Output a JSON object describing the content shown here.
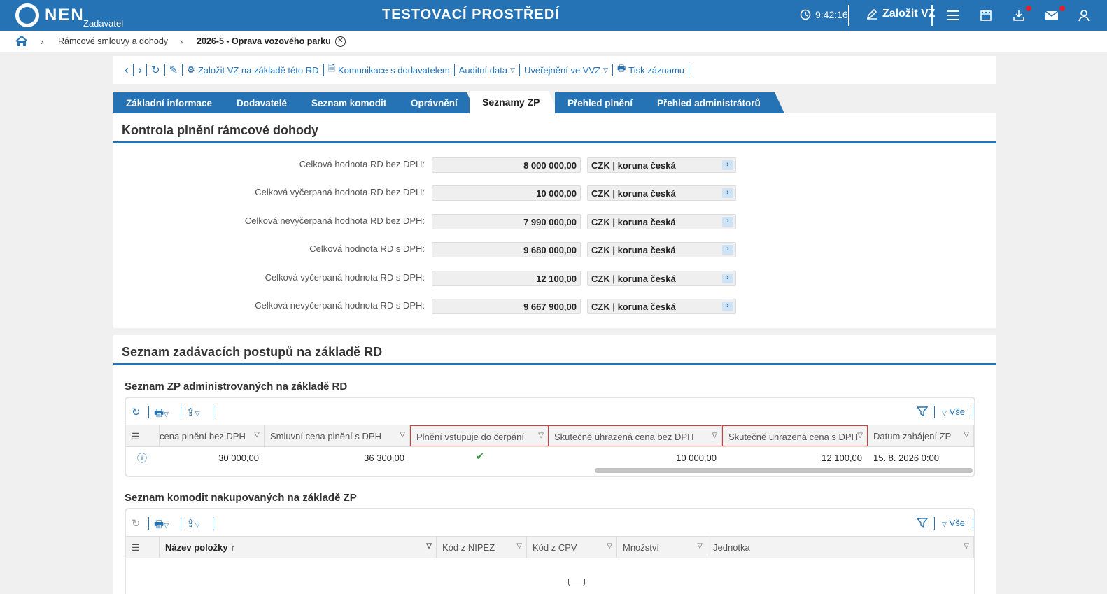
{
  "header": {
    "logo_text": "NEN",
    "logo_sub": "Zadavatel",
    "env_title": "TESTOVACÍ PROSTŘEDÍ",
    "clock": "9:42:16",
    "create_label": "Založit VZ"
  },
  "breadcrumb": {
    "items": [
      "Rámcové smlouvy a dohody",
      "2026-5 - Oprava vozového parku"
    ]
  },
  "toolbar": {
    "create_from": "Založit VZ na základě této RD",
    "communication": "Komunikace s dodavatelem",
    "audit": "Auditní data",
    "publish": "Uveřejnění ve VVZ",
    "print": "Tisk záznamu"
  },
  "tabs": [
    "Základní informace",
    "Dodavatelé",
    "Seznam komodit",
    "Oprávnění",
    "Seznamy ZP",
    "Přehled plnění",
    "Přehled administrátorů"
  ],
  "active_tab": "Seznamy ZP",
  "control": {
    "title": "Kontrola plnění rámcové dohody",
    "rows": [
      {
        "label": "Celková hodnota RD bez DPH:",
        "value": "8 000 000,00",
        "currency": "CZK | koruna česká"
      },
      {
        "label": "Celková vyčerpaná hodnota RD bez DPH:",
        "value": "10 000,00",
        "currency": "CZK | koruna česká"
      },
      {
        "label": "Celková nevyčerpaná hodnota RD bez DPH:",
        "value": "7 990 000,00",
        "currency": "CZK | koruna česká"
      },
      {
        "label": "Celková hodnota RD s DPH:",
        "value": "9 680 000,00",
        "currency": "CZK | koruna česká"
      },
      {
        "label": "Celková vyčerpaná hodnota RD s DPH:",
        "value": "12 100,00",
        "currency": "CZK | koruna česká"
      },
      {
        "label": "Celková nevyčerpaná hodnota RD s DPH:",
        "value": "9 667 900,00",
        "currency": "CZK | koruna česká"
      }
    ]
  },
  "list": {
    "title": "Seznam zadávacích postupů na základě RD",
    "zp_title": "Seznam ZP administrovaných na základě RD",
    "filter_all": "Vše",
    "zp_columns": [
      "cena plnění bez DPH",
      "Smluvní cena plnění s DPH",
      "Plnění vstupuje do čerpání",
      "Skutečně uhrazená cena bez DPH",
      "Skutečně uhrazená cena s DPH",
      "Datum zahájení ZP"
    ],
    "zp_row": {
      "price_no_vat": "30 000,00",
      "price_vat": "36 300,00",
      "paid_no_vat": "10 000,00",
      "paid_vat": "12 100,00",
      "start_date": "15. 8. 2026 0:00"
    },
    "com_title": "Seznam komodit nakupovaných na základě ZP",
    "com_columns": [
      "Název položky",
      "Kód z NIPEZ",
      "Kód z CPV",
      "Množství",
      "Jednotka"
    ]
  }
}
